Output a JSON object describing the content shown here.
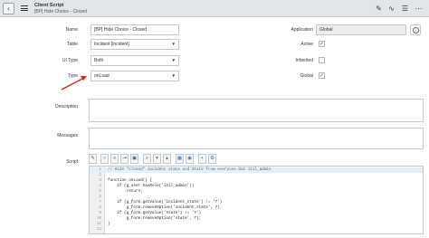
{
  "header": {
    "back_glyph": "‹",
    "title": "Client Script",
    "subtitle": "[BP] Hide Choice - Closed",
    "icons": [
      "paperclip-icon",
      "activity-icon",
      "sliders-icon",
      "more-icon"
    ]
  },
  "form": {
    "name_label": "Name",
    "name_value": "[BP] Hide Choice - Closed",
    "table_label": "Table",
    "table_value": "Incident [incident]",
    "ui_type_label": "UI Type",
    "ui_type_value": "Both",
    "type_label": "Type",
    "type_value": "onLoad",
    "application_label": "Application",
    "application_value": "Global",
    "active_label": "Active",
    "active_checked": "✓",
    "inherited_label": "Inherited",
    "global_label": "Global",
    "global_checked": "✓",
    "description_label": "Description",
    "messages_label": "Messages",
    "script_label": "Script",
    "caret": "▼"
  },
  "script": {
    "lines": [
      {
        "n": "1",
        "code": "// Hide \"Closed\" incident state and State from everyone but itil_admin"
      },
      {
        "n": "2",
        "code": ""
      },
      {
        "n": "3",
        "code": "function onLoad() {"
      },
      {
        "n": "4",
        "code": "    if (g_user.hasRole('itil_admin'))"
      },
      {
        "n": "5",
        "code": "        return;"
      },
      {
        "n": "6",
        "code": ""
      },
      {
        "n": "7",
        "code": "    if (g_form.getValue('incident_state') != '7')"
      },
      {
        "n": "8",
        "code": "        g_form.removeOption('incident_state', 7);"
      },
      {
        "n": "9",
        "code": "    if (g_form.getValue('state') != '7')"
      },
      {
        "n": "10",
        "code": "        g_form.removeOption('state', 7);"
      },
      {
        "n": "11",
        "code": "}"
      },
      {
        "n": "12",
        "code": ""
      }
    ]
  },
  "toolbar": {
    "buttons": [
      {
        "name": "toggle-syntax-icon",
        "glyph": "✎"
      },
      {
        "name": "comment-icon",
        "glyph": "○"
      },
      {
        "name": "format-icon",
        "glyph": "≡"
      },
      {
        "name": "indent-icon",
        "glyph": "⇥"
      },
      {
        "name": "fullscreen-icon",
        "glyph": "▣"
      },
      {
        "name": "search-icon",
        "glyph": "⌕"
      },
      {
        "name": "chevron-down-icon",
        "glyph": "▾"
      },
      {
        "name": "chevron-up-icon",
        "glyph": "▴"
      },
      {
        "name": "script-debug-icon",
        "glyph": "▦"
      },
      {
        "name": "help-icon",
        "glyph": "◉"
      },
      {
        "name": "save-icon",
        "glyph": "▪"
      },
      {
        "name": "tree-icon",
        "glyph": "⚙"
      }
    ]
  },
  "colors": {
    "arrow": "#d0261c",
    "header_bg": "#e3e6e8",
    "checkmark": "#2b5d8f"
  }
}
